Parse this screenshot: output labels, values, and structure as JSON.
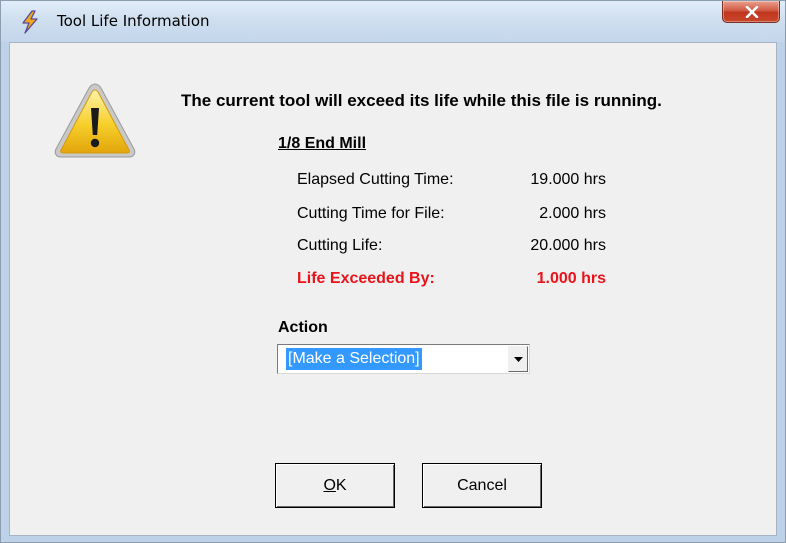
{
  "window": {
    "title": "Tool Life Information",
    "close_symbol": "X",
    "title_icon": "lightning-bolt-icon"
  },
  "dialog": {
    "icon": "warning-icon",
    "message": "The current tool will exceed its life while this file is running.",
    "tool_name": "1/8 End Mill",
    "rows": [
      {
        "label": "Elapsed Cutting Time:",
        "value": "19.000 hrs"
      },
      {
        "label": "Cutting Time for File:",
        "value": "2.000 hrs"
      },
      {
        "label": "Cutting Life:",
        "value": "20.000 hrs"
      },
      {
        "label": "Life Exceeded By:",
        "value": "1.000 hrs"
      }
    ],
    "exceeded_color": "#e8141a",
    "action_label": "Action",
    "action_selected": "[Make a Selection]"
  },
  "buttons": {
    "ok_mnemonic": "O",
    "ok_rest": "K",
    "cancel": "Cancel"
  }
}
